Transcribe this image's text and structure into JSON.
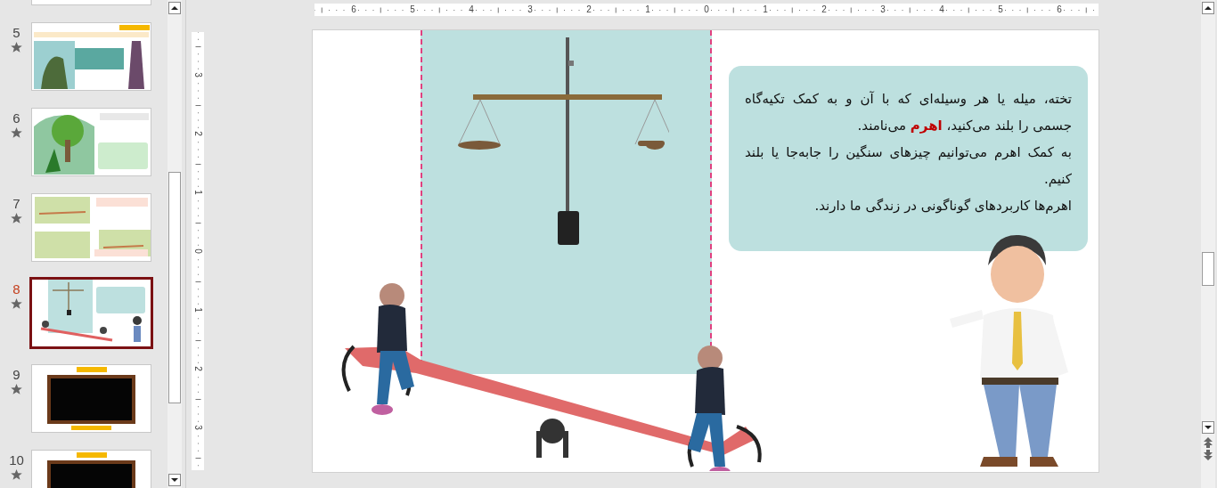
{
  "thumbnail_pane": {
    "slides": [
      {
        "kind": "partial",
        "selected": false
      },
      {
        "number": "5",
        "kind": "photo-text",
        "selected": false
      },
      {
        "number": "6",
        "kind": "park",
        "selected": false
      },
      {
        "number": "7",
        "kind": "seesaw-photos",
        "selected": false
      },
      {
        "number": "8",
        "kind": "lever",
        "selected": true
      },
      {
        "number": "9",
        "kind": "blackboard",
        "selected": false
      },
      {
        "number": "10",
        "kind": "blackboard",
        "selected": false
      }
    ]
  },
  "horizontal_ruler": {
    "labels": [
      "6",
      "5",
      "4",
      "3",
      "2",
      "1",
      "0",
      "1",
      "2",
      "3",
      "4",
      "5",
      "6"
    ]
  },
  "vertical_ruler": {
    "labels": [
      "3",
      "2",
      "1",
      "0",
      "1",
      "2",
      "3"
    ]
  },
  "slide": {
    "text_box": {
      "paragraphs": [
        "تخته، میله یا هر وسیله‌ای که با آن و به کمک تکیه‌گاه جسمی را بلند می‌کنید، **اهرم** می‌نامند.",
        "به کمک اهرم می‌توانیم چیزهای سنگین را جابه‌جا یا بلند کنیم.",
        "اهرم‌ها کاربردهای گوناگونی در زندگی ما دارند."
      ]
    }
  }
}
